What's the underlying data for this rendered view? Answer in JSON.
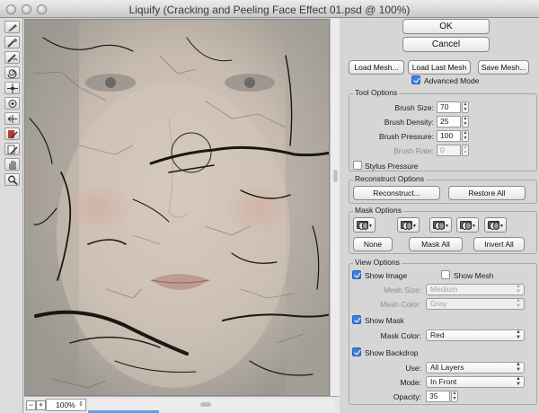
{
  "window": {
    "title": "Liquify (Cracking and Peeling Face Effect 01.psd @ 100%)"
  },
  "tools": [
    {
      "name": "forward-warp-tool"
    },
    {
      "name": "reconstruct-tool"
    },
    {
      "name": "smooth-tool"
    },
    {
      "name": "twirl-clockwise-tool"
    },
    {
      "name": "pucker-tool"
    },
    {
      "name": "bloat-tool"
    },
    {
      "name": "push-left-tool"
    },
    {
      "name": "freeze-mask-tool"
    },
    {
      "name": "thaw-mask-tool"
    },
    {
      "name": "hand-tool"
    },
    {
      "name": "zoom-tool"
    }
  ],
  "status": {
    "zoom": "100%",
    "zoom_out": "−",
    "zoom_in": "+",
    "progress": 0.23
  },
  "buttons": {
    "ok": "OK",
    "cancel": "Cancel",
    "load_mesh": "Load Mesh...",
    "load_last_mesh": "Load Last Mesh",
    "save_mesh": "Save Mesh..."
  },
  "advanced_mode": {
    "label": "Advanced Mode",
    "checked": true
  },
  "tool_options": {
    "title": "Tool Options",
    "brush_size": {
      "label": "Brush Size:",
      "value": "70"
    },
    "brush_density": {
      "label": "Brush Density:",
      "value": "25"
    },
    "brush_pressure": {
      "label": "Brush Pressure:",
      "value": "100"
    },
    "brush_rate": {
      "label": "Brush Rate:",
      "value": "0"
    },
    "stylus_pressure": {
      "label": "Stylus Pressure",
      "checked": false
    }
  },
  "reconstruct_options": {
    "title": "Reconstruct Options",
    "reconstruct": "Reconstruct...",
    "restore_all": "Restore All"
  },
  "mask_options": {
    "title": "Mask Options",
    "none": "None",
    "mask_all": "Mask All",
    "invert_all": "Invert All"
  },
  "view_options": {
    "title": "View Options",
    "show_image": {
      "label": "Show Image",
      "checked": true
    },
    "show_mesh": {
      "label": "Show Mesh",
      "checked": false
    },
    "mesh_size": {
      "label": "Mesh Size:",
      "value": "Medium"
    },
    "mesh_color": {
      "label": "Mesh Color:",
      "value": "Gray"
    },
    "show_mask": {
      "label": "Show Mask",
      "checked": true
    },
    "mask_color": {
      "label": "Mask Color:",
      "value": "Red"
    },
    "show_backdrop": {
      "label": "Show Backdrop",
      "checked": true
    },
    "use": {
      "label": "Use:",
      "value": "All Layers"
    },
    "mode": {
      "label": "Mode:",
      "value": "In Front"
    },
    "opacity": {
      "label": "Opacity:",
      "value": "35"
    }
  },
  "colors": {
    "accent": "#3d7fdc",
    "progress": "#5aa2e6",
    "panel": "#d6d6d6",
    "crack": "#1a1713"
  }
}
